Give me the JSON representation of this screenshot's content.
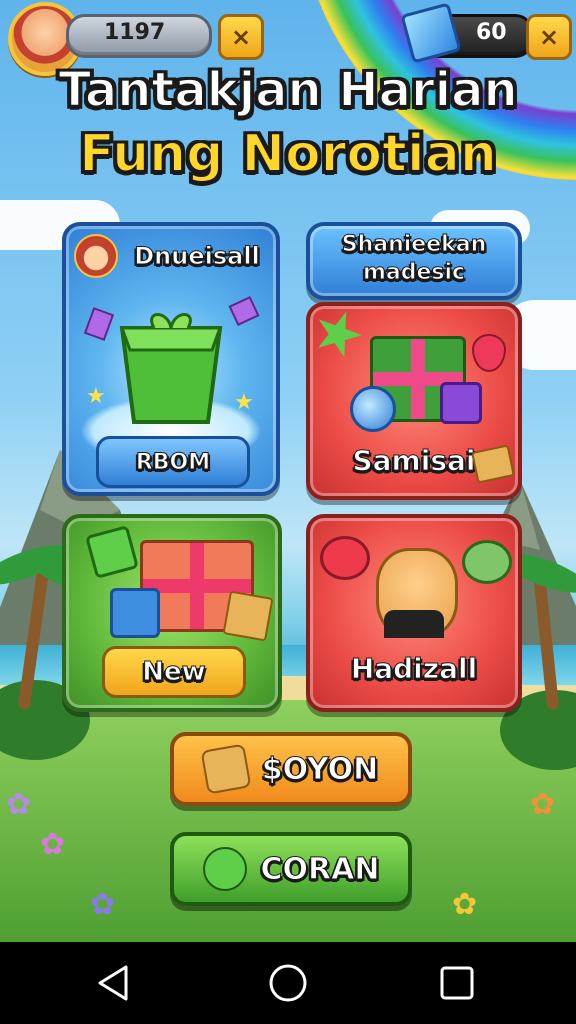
{
  "header": {
    "coins": "1197",
    "gems": "60",
    "close_icon": "×"
  },
  "title": {
    "line1": "Tantakjan Harian",
    "line2": "Fung Norotian"
  },
  "cards": {
    "daily": {
      "label": "Dnueisall",
      "button": "RBOM"
    },
    "special": {
      "label_line1": "Shanieekan",
      "label_line2": "madesic"
    },
    "bundle": {
      "label": "Samisai"
    },
    "new": {
      "button": "New"
    },
    "hadizall": {
      "label": "Hadizall"
    }
  },
  "buttons": {
    "orange": "$OYON",
    "green": "CORAN"
  },
  "colors": {
    "accent_yellow": "#ffd62a",
    "card_blue": "#2f7fd6",
    "card_red": "#ec4b47",
    "card_green": "#5fb83a"
  }
}
